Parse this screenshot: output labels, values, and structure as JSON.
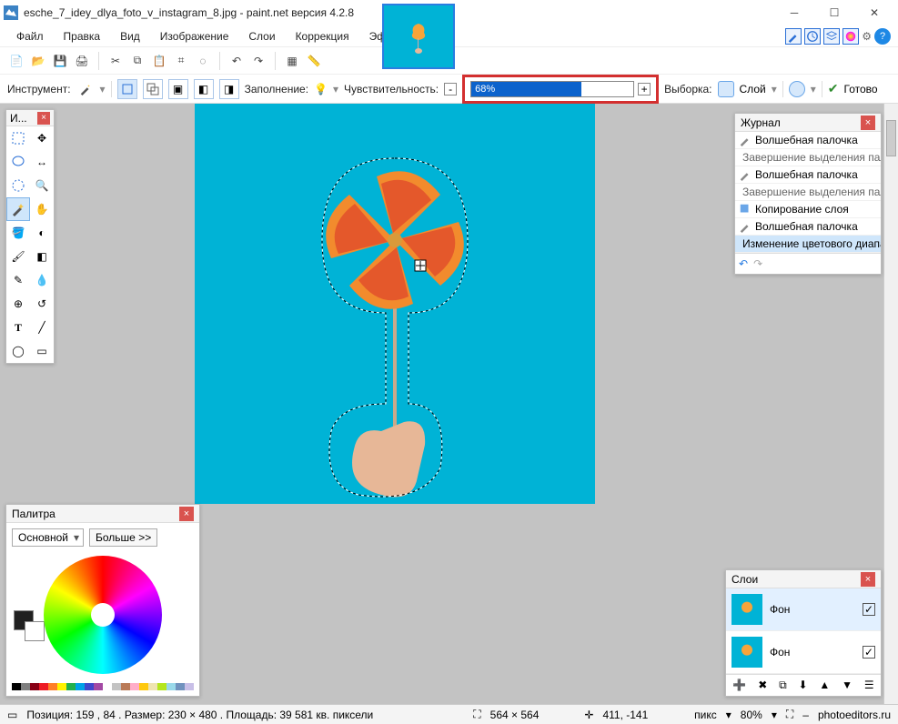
{
  "title": "esche_7_idey_dlya_foto_v_instagram_8.jpg - paint.net версия 4.2.8",
  "menu": [
    "Файл",
    "Правка",
    "Вид",
    "Изображение",
    "Слои",
    "Коррекция",
    "Эффекты"
  ],
  "options": {
    "tool_label": "Инструмент:",
    "fill_label": "Заполнение:",
    "tolerance_label": "Чувствительность:",
    "tolerance_value": "68%",
    "sampling_label": "Выборка:",
    "sampling_value": "Слой",
    "commit_label": "Готово"
  },
  "tools_title": "И...",
  "history": {
    "title": "Журнал",
    "items": [
      "Волшебная палочка",
      "Завершение выделения палочкой",
      "Волшебная палочка",
      "Завершение выделения палочкой",
      "Копирование слоя",
      "Волшебная палочка",
      "Изменение цветового диапазона"
    ]
  },
  "layers": {
    "title": "Слои",
    "items": [
      {
        "name": "Фон",
        "checked": true,
        "selected": true
      },
      {
        "name": "Фон",
        "checked": true,
        "selected": false
      }
    ]
  },
  "palette": {
    "title": "Палитра",
    "mode": "Основной",
    "more": "Больше >>"
  },
  "status": {
    "pos": "Позиция: 159 , 84 . Размер: 230   × 480 . Площадь: 39 581 кв. пиксели",
    "doc_size": "564 × 564",
    "cursor": "411, -141",
    "units": "пикс",
    "zoom": "80%",
    "site": "photoeditors.ru"
  },
  "swatch_colors": [
    "#000",
    "#7f7f7f",
    "#880015",
    "#ed1c24",
    "#ff7f27",
    "#fff200",
    "#22b14c",
    "#00a2e8",
    "#3f48cc",
    "#a349a4",
    "#fff",
    "#c3c3c3",
    "#b97a57",
    "#ffaec9",
    "#ffc90e",
    "#efe4b0",
    "#b5e61d",
    "#99d9ea",
    "#7092be",
    "#c8bfe7"
  ]
}
